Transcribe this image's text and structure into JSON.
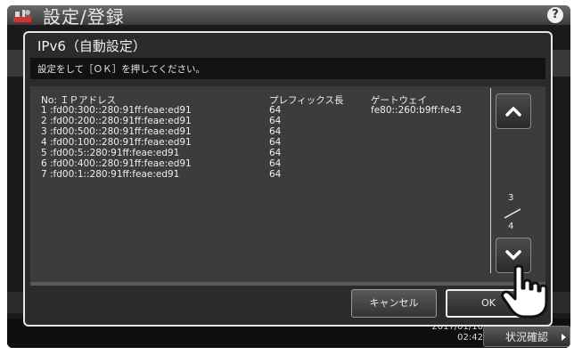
{
  "header": {
    "title": "設定/登録",
    "help_icon": "help-icon"
  },
  "dialog": {
    "title": "IPv6（自動設定）",
    "instruction": "設定をして［ＯＫ］を押してください。",
    "list": {
      "header": {
        "address": "No: ＩＰアドレス",
        "prefix": "プレフィックス長",
        "gateway": "ゲートウェイ"
      },
      "rows": [
        {
          "address": "1 :fd00:300::280:91ff:feae:ed91",
          "prefix": "64",
          "gateway": "fe80::260:b9ff:fe43"
        },
        {
          "address": "2 :fd00:200::280:91ff:feae:ed91",
          "prefix": "64",
          "gateway": ""
        },
        {
          "address": "3 :fd00:500::280:91ff:feae:ed91",
          "prefix": "64",
          "gateway": ""
        },
        {
          "address": "4 :fd00:100::280:91ff:feae:ed91",
          "prefix": "64",
          "gateway": ""
        },
        {
          "address": "5 :fd00:5::280:91ff:feae:ed91",
          "prefix": "64",
          "gateway": ""
        },
        {
          "address": "6 :fd00:400::280:91ff:feae:ed91",
          "prefix": "64",
          "gateway": ""
        },
        {
          "address": "7 :fd00:1::280:91ff:feae:ed91",
          "prefix": "64",
          "gateway": ""
        }
      ]
    },
    "pagination": {
      "current": "3",
      "total": "4"
    },
    "buttons": {
      "cancel": "キャンセル",
      "ok": "OK"
    }
  },
  "footer": {
    "datetime_line1": "2017/01/10",
    "time": "02:42",
    "status_button": "状況確認"
  },
  "icons": {
    "scroll_up": "chevron-up-icon",
    "scroll_down": "chevron-down-icon",
    "pointer": "hand-pointer-icon"
  }
}
